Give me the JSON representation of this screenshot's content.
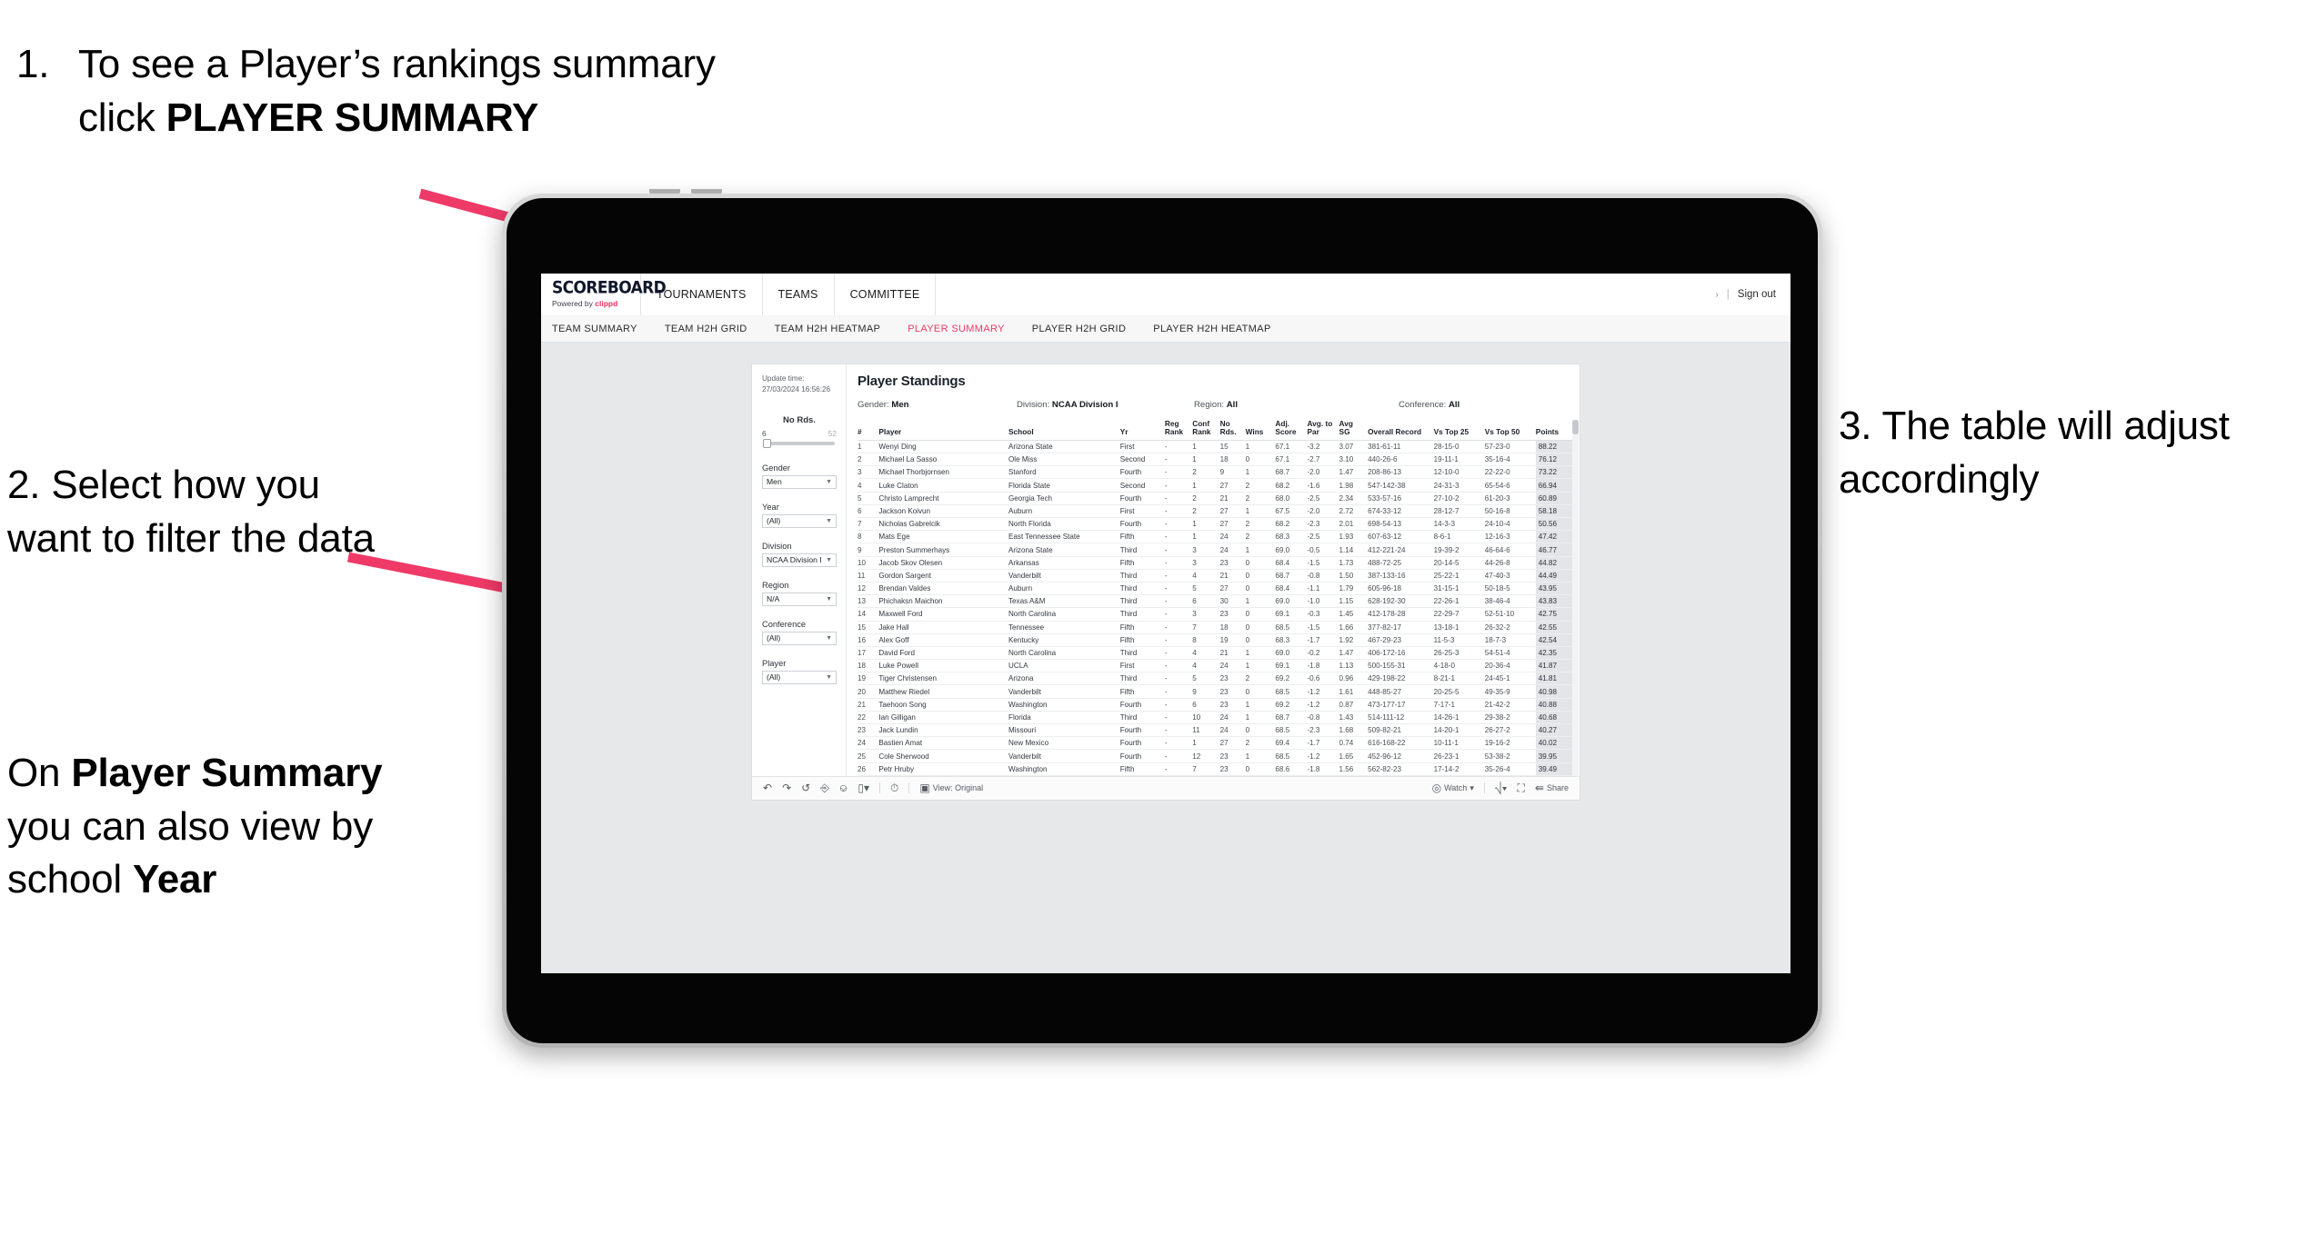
{
  "slide": {
    "callout1": {
      "number": "1.",
      "text_before": "To see a Player’s rankings summary click ",
      "text_bold": "PLAYER SUMMARY"
    },
    "callout2": {
      "text": "2. Select how you want to filter the data"
    },
    "callout2b": {
      "p1": "On ",
      "b1": "Player Summary",
      "p2": " you can also view by school ",
      "b2": "Year"
    },
    "callout3": {
      "text": "3. The table will adjust accordingly"
    },
    "accent_color": "#ed3a68"
  },
  "app": {
    "logo_word": "SCOREBOARD",
    "logo_powered_prefix": "Powered by ",
    "logo_brand": "clippd",
    "nav": [
      {
        "label": "TOURNAMENTS"
      },
      {
        "label": "TEAMS"
      },
      {
        "label": "COMMITTEE"
      }
    ],
    "right": {
      "caret": "›",
      "separator": "|",
      "signout": "Sign out"
    },
    "subnav": [
      {
        "label": "TEAM SUMMARY",
        "active": false
      },
      {
        "label": "TEAM H2H GRID",
        "active": false
      },
      {
        "label": "TEAM H2H HEATMAP",
        "active": false
      },
      {
        "label": "PLAYER SUMMARY",
        "active": true
      },
      {
        "label": "PLAYER H2H GRID",
        "active": false
      },
      {
        "label": "PLAYER H2H HEATMAP",
        "active": false
      }
    ]
  },
  "sheet": {
    "update_label": "Update time:",
    "update_value": "27/03/2024 16:56:26",
    "title": "Player Standings",
    "summary": {
      "gender_label": "Gender: ",
      "gender_value": "Men",
      "division_label": "Division: ",
      "division_value": "NCAA Division I",
      "region_label": "Region: ",
      "region_value": "All",
      "conference_label": "Conference: ",
      "conference_value": "All"
    },
    "slider": {
      "title": "No Rds.",
      "min": "6",
      "max": "52"
    },
    "filters": [
      {
        "label": "Gender",
        "value": "Men"
      },
      {
        "label": "Year",
        "value": "(All)"
      },
      {
        "label": "Division",
        "value": "NCAA Division I"
      },
      {
        "label": "Region",
        "value": "N/A"
      },
      {
        "label": "Conference",
        "value": "(All)"
      },
      {
        "label": "Player",
        "value": "(All)"
      }
    ],
    "toolbar": {
      "undo": "undo-icon",
      "redo": "redo-icon",
      "revert": "revert-icon",
      "refresh": "refresh-data-icon",
      "pause": "pause-updates-icon",
      "view_menu": "view-dropdown-icon",
      "alert": "alert-icon",
      "view_label": "View: Original",
      "watch_label": "Watch",
      "download_icon": "download-icon",
      "fullscreen_icon": "fullscreen-icon",
      "share_label": "Share"
    }
  },
  "table": {
    "columns": [
      {
        "key": "rank",
        "header": "#"
      },
      {
        "key": "player",
        "header": "Player"
      },
      {
        "key": "school",
        "header": "School"
      },
      {
        "key": "yr",
        "header": "Yr"
      },
      {
        "key": "reg_rank",
        "header": "Reg Rank"
      },
      {
        "key": "conf_rank",
        "header": "Conf Rank"
      },
      {
        "key": "no_rds",
        "header": "No Rds."
      },
      {
        "key": "wins",
        "header": "Wins"
      },
      {
        "key": "adj_score",
        "header": "Adj. Score"
      },
      {
        "key": "avg_to_par",
        "header": "Avg. to Par"
      },
      {
        "key": "avg_sg",
        "header": "Avg SG"
      },
      {
        "key": "overall_record",
        "header": "Overall Record"
      },
      {
        "key": "vs_top25",
        "header": "Vs Top 25"
      },
      {
        "key": "vs_top50",
        "header": "Vs Top 50"
      },
      {
        "key": "points",
        "header": "Points"
      }
    ],
    "rows": [
      {
        "rank": "1",
        "player": "Wenyi Ding",
        "school": "Arizona State",
        "yr": "First",
        "reg_rank": "-",
        "conf_rank": "1",
        "no_rds": "15",
        "wins": "1",
        "adj_score": "67.1",
        "avg_to_par": "-3.2",
        "avg_sg": "3.07",
        "overall_record": "381-61-11",
        "vs_top25": "28-15-0",
        "vs_top50": "57-23-0",
        "points": "88.22"
      },
      {
        "rank": "2",
        "player": "Michael La Sasso",
        "school": "Ole Miss",
        "yr": "Second",
        "reg_rank": "-",
        "conf_rank": "1",
        "no_rds": "18",
        "wins": "0",
        "adj_score": "67.1",
        "avg_to_par": "-2.7",
        "avg_sg": "3.10",
        "overall_record": "440-26-6",
        "vs_top25": "19-11-1",
        "vs_top50": "35-16-4",
        "points": "76.12"
      },
      {
        "rank": "3",
        "player": "Michael Thorbjornsen",
        "school": "Stanford",
        "yr": "Fourth",
        "reg_rank": "-",
        "conf_rank": "2",
        "no_rds": "9",
        "wins": "1",
        "adj_score": "68.7",
        "avg_to_par": "-2.0",
        "avg_sg": "1.47",
        "overall_record": "208-86-13",
        "vs_top25": "12-10-0",
        "vs_top50": "22-22-0",
        "points": "73.22"
      },
      {
        "rank": "4",
        "player": "Luke Claton",
        "school": "Florida State",
        "yr": "Second",
        "reg_rank": "-",
        "conf_rank": "1",
        "no_rds": "27",
        "wins": "2",
        "adj_score": "68.2",
        "avg_to_par": "-1.6",
        "avg_sg": "1.98",
        "overall_record": "547-142-38",
        "vs_top25": "24-31-3",
        "vs_top50": "65-54-6",
        "points": "66.94"
      },
      {
        "rank": "5",
        "player": "Christo Lamprecht",
        "school": "Georgia Tech",
        "yr": "Fourth",
        "reg_rank": "-",
        "conf_rank": "2",
        "no_rds": "21",
        "wins": "2",
        "adj_score": "68.0",
        "avg_to_par": "-2.5",
        "avg_sg": "2.34",
        "overall_record": "533-57-16",
        "vs_top25": "27-10-2",
        "vs_top50": "61-20-3",
        "points": "60.89"
      },
      {
        "rank": "6",
        "player": "Jackson Koivun",
        "school": "Auburn",
        "yr": "First",
        "reg_rank": "-",
        "conf_rank": "2",
        "no_rds": "27",
        "wins": "1",
        "adj_score": "67.5",
        "avg_to_par": "-2.0",
        "avg_sg": "2.72",
        "overall_record": "674-33-12",
        "vs_top25": "28-12-7",
        "vs_top50": "50-16-8",
        "points": "58.18"
      },
      {
        "rank": "7",
        "player": "Nicholas Gabrelcik",
        "school": "North Florida",
        "yr": "Fourth",
        "reg_rank": "-",
        "conf_rank": "1",
        "no_rds": "27",
        "wins": "2",
        "adj_score": "68.2",
        "avg_to_par": "-2.3",
        "avg_sg": "2.01",
        "overall_record": "698-54-13",
        "vs_top25": "14-3-3",
        "vs_top50": "24-10-4",
        "points": "50.56"
      },
      {
        "rank": "8",
        "player": "Mats Ege",
        "school": "East Tennessee State",
        "yr": "Fifth",
        "reg_rank": "-",
        "conf_rank": "1",
        "no_rds": "24",
        "wins": "2",
        "adj_score": "68.3",
        "avg_to_par": "-2.5",
        "avg_sg": "1.93",
        "overall_record": "607-63-12",
        "vs_top25": "8-6-1",
        "vs_top50": "12-16-3",
        "points": "47.42"
      },
      {
        "rank": "9",
        "player": "Preston Summerhays",
        "school": "Arizona State",
        "yr": "Third",
        "reg_rank": "-",
        "conf_rank": "3",
        "no_rds": "24",
        "wins": "1",
        "adj_score": "69.0",
        "avg_to_par": "-0.5",
        "avg_sg": "1.14",
        "overall_record": "412-221-24",
        "vs_top25": "19-39-2",
        "vs_top50": "46-64-6",
        "points": "46.77"
      },
      {
        "rank": "10",
        "player": "Jacob Skov Olesen",
        "school": "Arkansas",
        "yr": "Fifth",
        "reg_rank": "-",
        "conf_rank": "3",
        "no_rds": "23",
        "wins": "0",
        "adj_score": "68.4",
        "avg_to_par": "-1.5",
        "avg_sg": "1.73",
        "overall_record": "488-72-25",
        "vs_top25": "20-14-5",
        "vs_top50": "44-26-8",
        "points": "44.82"
      },
      {
        "rank": "11",
        "player": "Gordon Sargent",
        "school": "Vanderbilt",
        "yr": "Third",
        "reg_rank": "-",
        "conf_rank": "4",
        "no_rds": "21",
        "wins": "0",
        "adj_score": "68.7",
        "avg_to_par": "-0.8",
        "avg_sg": "1.50",
        "overall_record": "387-133-16",
        "vs_top25": "25-22-1",
        "vs_top50": "47-40-3",
        "points": "44.49"
      },
      {
        "rank": "12",
        "player": "Brendan Valdes",
        "school": "Auburn",
        "yr": "Third",
        "reg_rank": "-",
        "conf_rank": "5",
        "no_rds": "27",
        "wins": "0",
        "adj_score": "68.4",
        "avg_to_par": "-1.1",
        "avg_sg": "1.79",
        "overall_record": "605-96-18",
        "vs_top25": "31-15-1",
        "vs_top50": "50-18-5",
        "points": "43.95"
      },
      {
        "rank": "13",
        "player": "Phichaksn Maichon",
        "school": "Texas A&M",
        "yr": "Third",
        "reg_rank": "-",
        "conf_rank": "6",
        "no_rds": "30",
        "wins": "1",
        "adj_score": "69.0",
        "avg_to_par": "-1.0",
        "avg_sg": "1.15",
        "overall_record": "628-192-30",
        "vs_top25": "22-26-1",
        "vs_top50": "38-46-4",
        "points": "43.83"
      },
      {
        "rank": "14",
        "player": "Maxwell Ford",
        "school": "North Carolina",
        "yr": "Third",
        "reg_rank": "-",
        "conf_rank": "3",
        "no_rds": "23",
        "wins": "0",
        "adj_score": "69.1",
        "avg_to_par": "-0.3",
        "avg_sg": "1.45",
        "overall_record": "412-178-28",
        "vs_top25": "22-29-7",
        "vs_top50": "52-51-10",
        "points": "42.75"
      },
      {
        "rank": "15",
        "player": "Jake Hall",
        "school": "Tennessee",
        "yr": "Fifth",
        "reg_rank": "-",
        "conf_rank": "7",
        "no_rds": "18",
        "wins": "0",
        "adj_score": "68.5",
        "avg_to_par": "-1.5",
        "avg_sg": "1.66",
        "overall_record": "377-82-17",
        "vs_top25": "13-18-1",
        "vs_top50": "26-32-2",
        "points": "42.55"
      },
      {
        "rank": "16",
        "player": "Alex Goff",
        "school": "Kentucky",
        "yr": "Fifth",
        "reg_rank": "-",
        "conf_rank": "8",
        "no_rds": "19",
        "wins": "0",
        "adj_score": "68.3",
        "avg_to_par": "-1.7",
        "avg_sg": "1.92",
        "overall_record": "467-29-23",
        "vs_top25": "11-5-3",
        "vs_top50": "18-7-3",
        "points": "42.54"
      },
      {
        "rank": "17",
        "player": "David Ford",
        "school": "North Carolina",
        "yr": "Third",
        "reg_rank": "-",
        "conf_rank": "4",
        "no_rds": "21",
        "wins": "1",
        "adj_score": "69.0",
        "avg_to_par": "-0.2",
        "avg_sg": "1.47",
        "overall_record": "406-172-16",
        "vs_top25": "26-25-3",
        "vs_top50": "54-51-4",
        "points": "42.35"
      },
      {
        "rank": "18",
        "player": "Luke Powell",
        "school": "UCLA",
        "yr": "First",
        "reg_rank": "-",
        "conf_rank": "4",
        "no_rds": "24",
        "wins": "1",
        "adj_score": "69.1",
        "avg_to_par": "-1.8",
        "avg_sg": "1.13",
        "overall_record": "500-155-31",
        "vs_top25": "4-18-0",
        "vs_top50": "20-36-4",
        "points": "41.87"
      },
      {
        "rank": "19",
        "player": "Tiger Christensen",
        "school": "Arizona",
        "yr": "Third",
        "reg_rank": "-",
        "conf_rank": "5",
        "no_rds": "23",
        "wins": "2",
        "adj_score": "69.2",
        "avg_to_par": "-0.6",
        "avg_sg": "0.96",
        "overall_record": "429-198-22",
        "vs_top25": "8-21-1",
        "vs_top50": "24-45-1",
        "points": "41.81"
      },
      {
        "rank": "20",
        "player": "Matthew Riedel",
        "school": "Vanderbilt",
        "yr": "Fifth",
        "reg_rank": "-",
        "conf_rank": "9",
        "no_rds": "23",
        "wins": "0",
        "adj_score": "68.5",
        "avg_to_par": "-1.2",
        "avg_sg": "1.61",
        "overall_record": "448-85-27",
        "vs_top25": "20-25-5",
        "vs_top50": "49-35-9",
        "points": "40.98"
      },
      {
        "rank": "21",
        "player": "Taehoon Song",
        "school": "Washington",
        "yr": "Fourth",
        "reg_rank": "-",
        "conf_rank": "6",
        "no_rds": "23",
        "wins": "1",
        "adj_score": "69.2",
        "avg_to_par": "-1.2",
        "avg_sg": "0.87",
        "overall_record": "473-177-17",
        "vs_top25": "7-17-1",
        "vs_top50": "21-42-2",
        "points": "40.88"
      },
      {
        "rank": "22",
        "player": "Ian Gilligan",
        "school": "Florida",
        "yr": "Third",
        "reg_rank": "-",
        "conf_rank": "10",
        "no_rds": "24",
        "wins": "1",
        "adj_score": "68.7",
        "avg_to_par": "-0.8",
        "avg_sg": "1.43",
        "overall_record": "514-111-12",
        "vs_top25": "14-26-1",
        "vs_top50": "29-38-2",
        "points": "40.68"
      },
      {
        "rank": "23",
        "player": "Jack Lundin",
        "school": "Missouri",
        "yr": "Fourth",
        "reg_rank": "-",
        "conf_rank": "11",
        "no_rds": "24",
        "wins": "0",
        "adj_score": "68.5",
        "avg_to_par": "-2.3",
        "avg_sg": "1.68",
        "overall_record": "509-82-21",
        "vs_top25": "14-20-1",
        "vs_top50": "26-27-2",
        "points": "40.27"
      },
      {
        "rank": "24",
        "player": "Bastien Amat",
        "school": "New Mexico",
        "yr": "Fourth",
        "reg_rank": "-",
        "conf_rank": "1",
        "no_rds": "27",
        "wins": "2",
        "adj_score": "69.4",
        "avg_to_par": "-1.7",
        "avg_sg": "0.74",
        "overall_record": "616-168-22",
        "vs_top25": "10-11-1",
        "vs_top50": "19-16-2",
        "points": "40.02"
      },
      {
        "rank": "25",
        "player": "Cole Sherwood",
        "school": "Vanderbilt",
        "yr": "Fourth",
        "reg_rank": "-",
        "conf_rank": "12",
        "no_rds": "23",
        "wins": "1",
        "adj_score": "68.5",
        "avg_to_par": "-1.2",
        "avg_sg": "1.65",
        "overall_record": "452-96-12",
        "vs_top25": "26-23-1",
        "vs_top50": "53-38-2",
        "points": "39.95"
      },
      {
        "rank": "26",
        "player": "Petr Hruby",
        "school": "Washington",
        "yr": "Fifth",
        "reg_rank": "-",
        "conf_rank": "7",
        "no_rds": "23",
        "wins": "0",
        "adj_score": "68.6",
        "avg_to_par": "-1.8",
        "avg_sg": "1.56",
        "overall_record": "562-82-23",
        "vs_top25": "17-14-2",
        "vs_top50": "35-26-4",
        "points": "39.49"
      }
    ]
  }
}
